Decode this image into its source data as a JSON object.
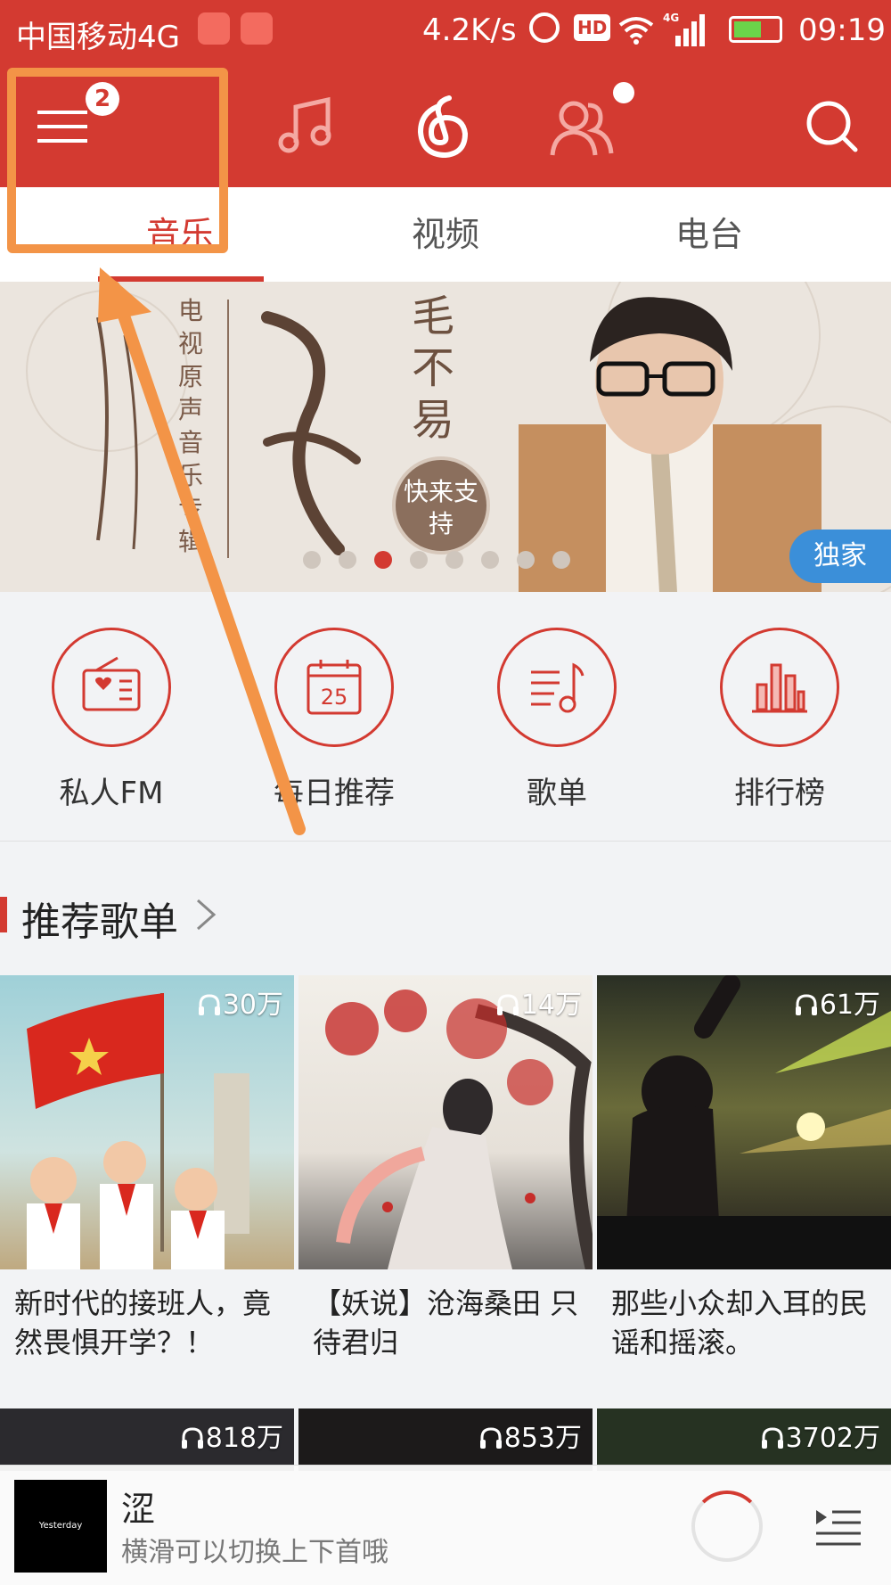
{
  "status_bar": {
    "carrier": "中国移动4G",
    "speed": "4.2K/s",
    "hd": "HD",
    "network": "4G",
    "time": "09:19"
  },
  "top_nav": {
    "menu_badge": "2",
    "icons": [
      "menu-icon",
      "music-icon",
      "netease-logo-icon",
      "friends-icon",
      "search-icon"
    ]
  },
  "tabs": [
    {
      "label": "音乐",
      "active": true
    },
    {
      "label": "视频",
      "active": false
    },
    {
      "label": "电台",
      "active": false
    }
  ],
  "banner": {
    "side_text": "电视原声音乐专辑",
    "title": "毛不易",
    "button": "快来支持",
    "tag": "独家",
    "pages": 8,
    "active_page": 3
  },
  "quick_entries": [
    {
      "label": "私人FM",
      "icon": "radio-icon"
    },
    {
      "label": "每日推荐",
      "icon": "calendar-icon",
      "date": "25"
    },
    {
      "label": "歌单",
      "icon": "playlist-icon"
    },
    {
      "label": "排行榜",
      "icon": "chart-icon"
    }
  ],
  "section": {
    "title": "推荐歌单"
  },
  "playlists": [
    {
      "count": "30万",
      "title": "新时代的接班人，竟然畏惧开学？！"
    },
    {
      "count": "14万",
      "title": "【妖说】沧海桑田 只待君归"
    },
    {
      "count": "61万",
      "title": "那些小众却入耳的民谣和摇滚。"
    },
    {
      "count": "818万",
      "title": ""
    },
    {
      "count": "853万",
      "title": ""
    },
    {
      "count": "3702万",
      "title": ""
    }
  ],
  "player": {
    "song": "涩",
    "hint": "横滑可以切换上下首哦",
    "thumb_text": "Yesterday"
  },
  "colors": {
    "brand": "#d33a31",
    "annotation": "#f39447",
    "exclusive": "#3b8fd9"
  }
}
